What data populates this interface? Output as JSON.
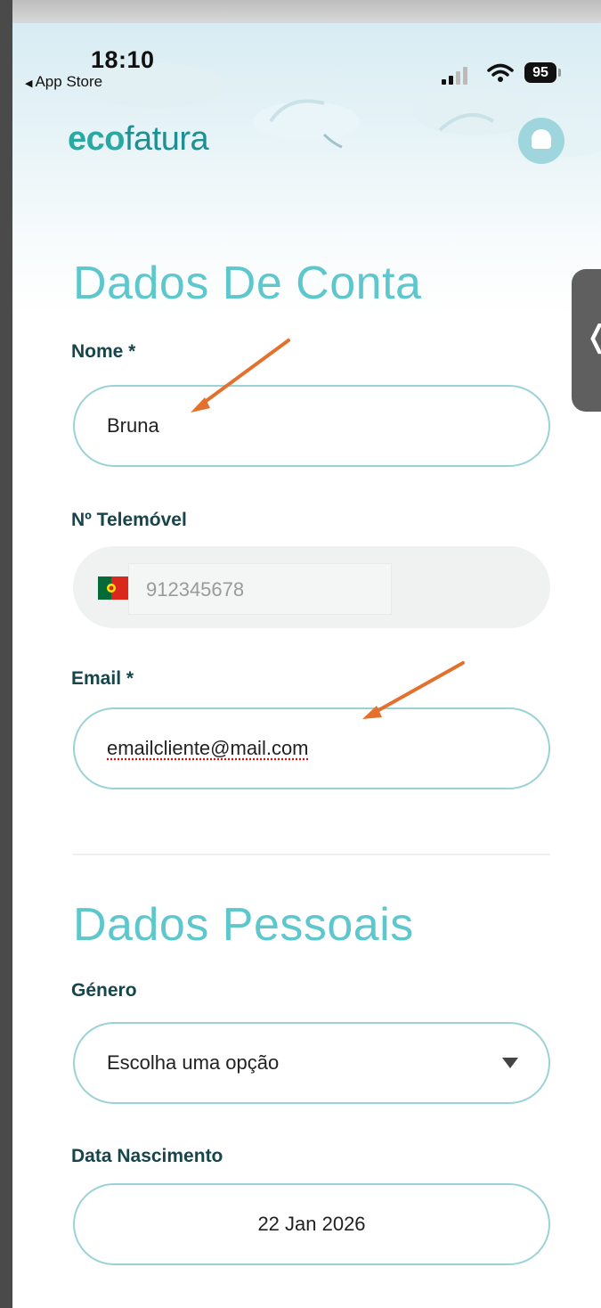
{
  "status_bar": {
    "time": "18:10",
    "back_app": "App Store",
    "battery": "95"
  },
  "header": {
    "logo_eco": "eco",
    "logo_fatura": "fatura",
    "bell_icon": "bell-icon"
  },
  "side_tab": {
    "icon": "chevron-left-icon",
    "glyph": "❬"
  },
  "account": {
    "title": "Dados De Conta",
    "name_label": "Nome *",
    "name_value": "Bruna",
    "phone_label": "Nº Telemóvel",
    "phone_value": "912345678",
    "phone_flag": "portugal-flag-icon",
    "email_label": "Email *",
    "email_value": "emailcliente@mail.com"
  },
  "personal": {
    "title": "Dados Pessoais",
    "gender_label": "Género",
    "gender_value": "Escolha uma opção",
    "birth_label": "Data Nascimento",
    "birth_value": "22 Jan 2026"
  },
  "colors": {
    "accent": "#5ec7cd",
    "label": "#16454b",
    "border": "#9ad2d8",
    "annotation_arrow": "#e3702d"
  }
}
